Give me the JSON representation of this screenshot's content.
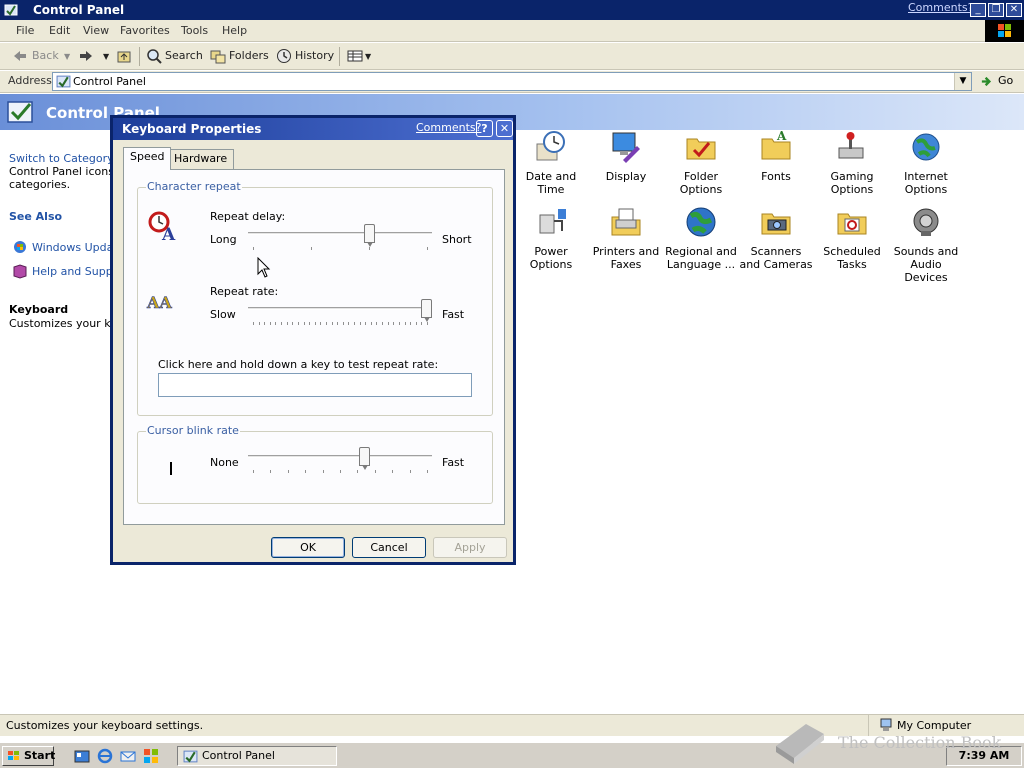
{
  "window": {
    "title": "Control Panel",
    "comments_link": "Comments?",
    "minimize": "_",
    "restore": "❐",
    "close": "✕"
  },
  "menu": [
    "File",
    "Edit",
    "View",
    "Favorites",
    "Tools",
    "Help"
  ],
  "toolbar": {
    "back": "Back",
    "forward": "",
    "search": "Search",
    "folders": "Folders",
    "history": "History"
  },
  "address": {
    "label": "Address",
    "value": "Control Panel",
    "go": "Go"
  },
  "banner": {
    "title": "Control Panel"
  },
  "left_pane": {
    "switch_link": "Switch to Category v",
    "desc_line1": "Control Panel icons g",
    "desc_line2": "categories.",
    "see_also": "See Also",
    "windows_update": "Windows Update",
    "help_support": "Help and Suppor",
    "details_title": "Keyboard",
    "details_desc": "Customizes your keyl"
  },
  "icons": [
    {
      "label": "Date and Time",
      "icon": "clock-icon"
    },
    {
      "label": "Display",
      "icon": "display-icon"
    },
    {
      "label": "Folder Options",
      "icon": "folder-options-icon"
    },
    {
      "label": "Fonts",
      "icon": "fonts-icon"
    },
    {
      "label": "Gaming Options",
      "icon": "gaming-icon"
    },
    {
      "label": "Internet Options",
      "icon": "globe-icon"
    },
    {
      "label": "Power Options",
      "icon": "power-icon"
    },
    {
      "label": "Printers and Faxes",
      "icon": "printer-icon"
    },
    {
      "label": "Regional and Language ...",
      "icon": "globe-icon"
    },
    {
      "label": "Scanners and Cameras",
      "icon": "camera-icon"
    },
    {
      "label": "Scheduled Tasks",
      "icon": "scheduled-tasks-icon"
    },
    {
      "label": "Sounds and Audio Devices",
      "icon": "speaker-icon"
    }
  ],
  "dialog": {
    "title": "Keyboard Properties",
    "comments_link": "Comments?",
    "help": "?",
    "close": "✕",
    "tabs": [
      "Speed",
      "Hardware"
    ],
    "character_repeat": {
      "group_title": "Character repeat",
      "repeat_delay_label": "Repeat delay:",
      "repeat_delay_min": "Long",
      "repeat_delay_max": "Short",
      "repeat_delay_value": 0.67,
      "repeat_rate_label": "Repeat rate:",
      "repeat_rate_min": "Slow",
      "repeat_rate_max": "Fast",
      "repeat_rate_value": 1.0,
      "test_label": "Click here and hold down a key to test repeat rate:",
      "test_value": ""
    },
    "cursor_blink": {
      "group_title": "Cursor blink rate",
      "min": "None",
      "max": "Fast",
      "value": 0.64
    },
    "buttons": {
      "ok": "OK",
      "cancel": "Cancel",
      "apply": "Apply"
    }
  },
  "status": {
    "text": "Customizes your keyboard settings.",
    "zone": "My Computer"
  },
  "taskbar": {
    "start": "Start",
    "task": "Control Panel",
    "clock": "7:39 AM"
  },
  "watermark": "The Collection Book"
}
